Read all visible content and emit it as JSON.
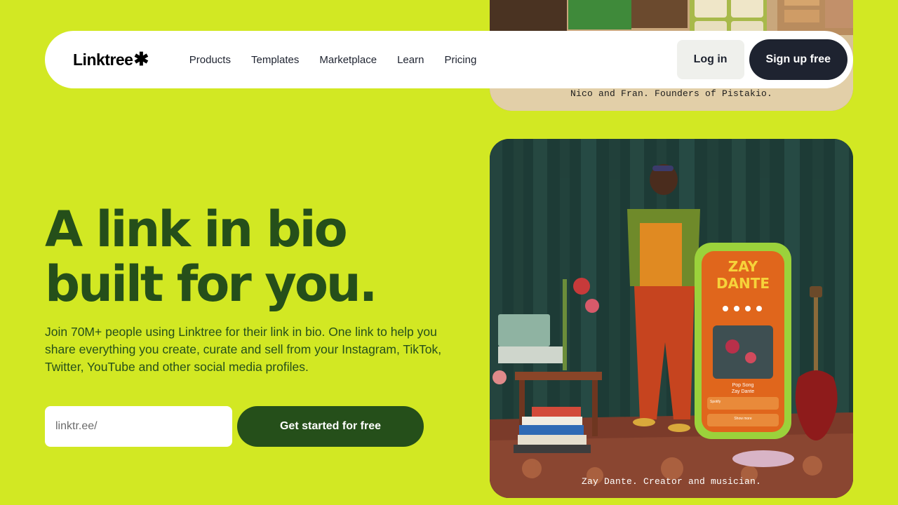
{
  "nav": {
    "logo_text": "Linktree",
    "logo_mark": "✱",
    "links": [
      "Products",
      "Templates",
      "Marketplace",
      "Learn",
      "Pricing"
    ],
    "login_label": "Log in",
    "signup_label": "Sign up free"
  },
  "top_card": {
    "caption": "Nico and Fran. Founders of Pistakio."
  },
  "hero": {
    "title_line1": "A link in bio",
    "title_line2": "built for you.",
    "subtitle": "Join 70M+ people using Linktree for their link in bio. One link to help you share everything you create, curate and sell from your Instagram, TikTok, Twitter, YouTube and other social media profiles.",
    "input_value": "linktr.ee/",
    "cta_label": "Get started for free"
  },
  "main_card": {
    "caption": "Zay Dante. Creator and musician.",
    "phone_title_1": "ZAY",
    "phone_title_2": "DANTE",
    "song_title": "Pop Song",
    "song_artist": "Zay Dante",
    "spotify_label": "Spotify",
    "show_more": "Show more"
  },
  "colors": {
    "background": "#d2e823",
    "hero_text": "#254f1a",
    "cta_bg": "#254f1a",
    "signup_bg": "#1e2330"
  }
}
